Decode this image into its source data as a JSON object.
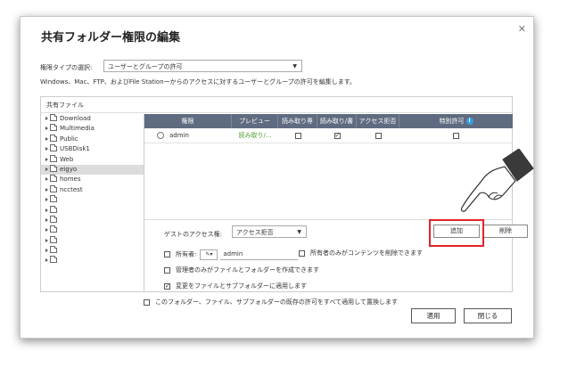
{
  "dialog": {
    "title": "共有フォルダー権限の編集",
    "close_icon": "close-icon",
    "permission_type_label": "権限タイプの選択:",
    "permission_type_value": "ユーザーとグループの許可",
    "description": "Windows、Mac、FTP、およびFile Stationーからのアクセスに対するユーザーとグループの許可を編集します。",
    "panel_title": "共有ファイル"
  },
  "tree": {
    "items": [
      {
        "label": "Download",
        "selected": false
      },
      {
        "label": "Multimedia",
        "selected": false
      },
      {
        "label": "Public",
        "selected": false
      },
      {
        "label": "USBDisk1",
        "selected": false
      },
      {
        "label": "Web",
        "selected": false
      },
      {
        "label": "eigyo",
        "selected": true
      },
      {
        "label": "homes",
        "selected": false
      },
      {
        "label": "ncctest",
        "selected": false
      },
      {
        "label": "",
        "selected": false
      },
      {
        "label": "",
        "selected": false
      },
      {
        "label": "",
        "selected": false
      },
      {
        "label": "",
        "selected": false
      },
      {
        "label": "",
        "selected": false
      },
      {
        "label": "",
        "selected": false
      },
      {
        "label": "",
        "selected": false
      }
    ]
  },
  "grid": {
    "headers": [
      "権限",
      "プレビュー",
      "読み取り専",
      "読み取り/書",
      "アクセス拒否",
      "特別許可"
    ],
    "rows": [
      {
        "user": "admin",
        "preview": "読み取り/...",
        "read_only": false,
        "read_write": true,
        "deny": false,
        "special": false
      }
    ]
  },
  "guest": {
    "label": "ゲストのアクセス権:",
    "value": "アクセス拒否"
  },
  "buttons": {
    "add": "追加",
    "remove": "削除",
    "apply": "適用",
    "close": "閉じる"
  },
  "options": {
    "owner_label": "所有者:",
    "owner_value": "admin",
    "owner_delete_only": "所有者のみがコンテンツを削除できます",
    "admin_create_only": "管理者のみがファイルとフォルダーを作成できます",
    "apply_subfolders": "変更をファイルとサブフォルダーに適用します",
    "replace_all": "このフォルダー、ファイル、サブフォルダーの既存の許可をすべて適用して置換します"
  },
  "option_states": {
    "owner": false,
    "owner_delete_only": false,
    "admin_create_only": false,
    "apply_subfolders": true,
    "replace_all": false
  },
  "colors": {
    "grid_header": "#5f6b80",
    "highlight": "#e0242a",
    "info": "#3a9ee8",
    "preview_text": "#4aa02c"
  }
}
